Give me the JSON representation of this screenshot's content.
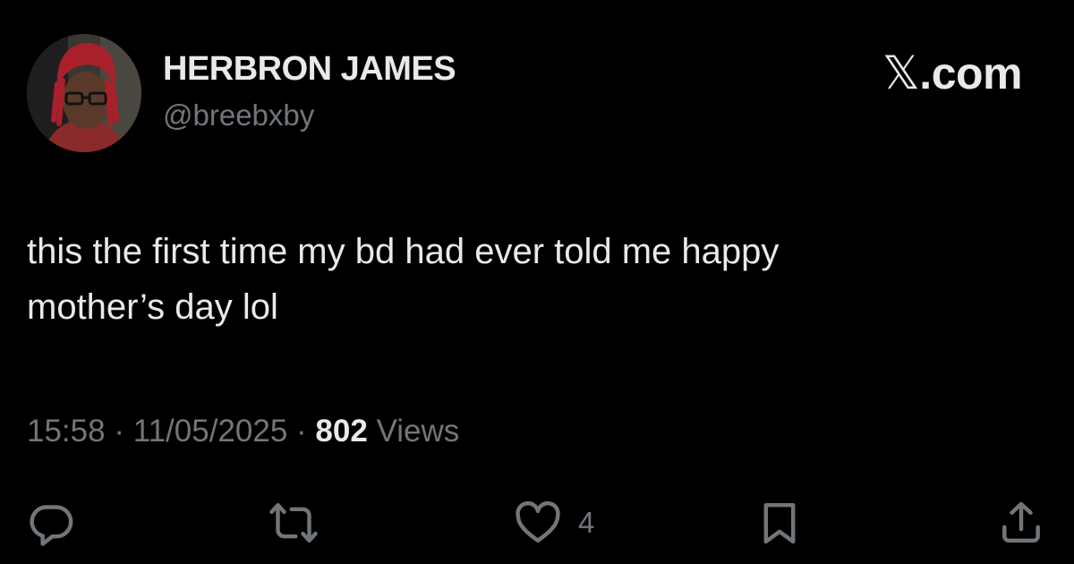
{
  "author": {
    "display_name": "HERBRON JAMES",
    "handle": "@breebxby"
  },
  "brand": {
    "label": ".com",
    "mark_glyph": "𝕏"
  },
  "tweet": {
    "text": "this the first time my bd had ever told me happy\nmother’s day lol",
    "time": "15:58",
    "separator": "·",
    "date": "11/05/2025",
    "views_count": "802",
    "views_label": "Views"
  },
  "actions": {
    "reply_icon": "reply-icon",
    "repost_icon": "repost-icon",
    "like_icon": "heart-icon",
    "like_count": "4",
    "bookmark_icon": "bookmark-icon",
    "share_icon": "share-icon"
  },
  "colors": {
    "background": "#000000",
    "primary_text": "#e7e9ea",
    "secondary_text": "#71767b"
  }
}
